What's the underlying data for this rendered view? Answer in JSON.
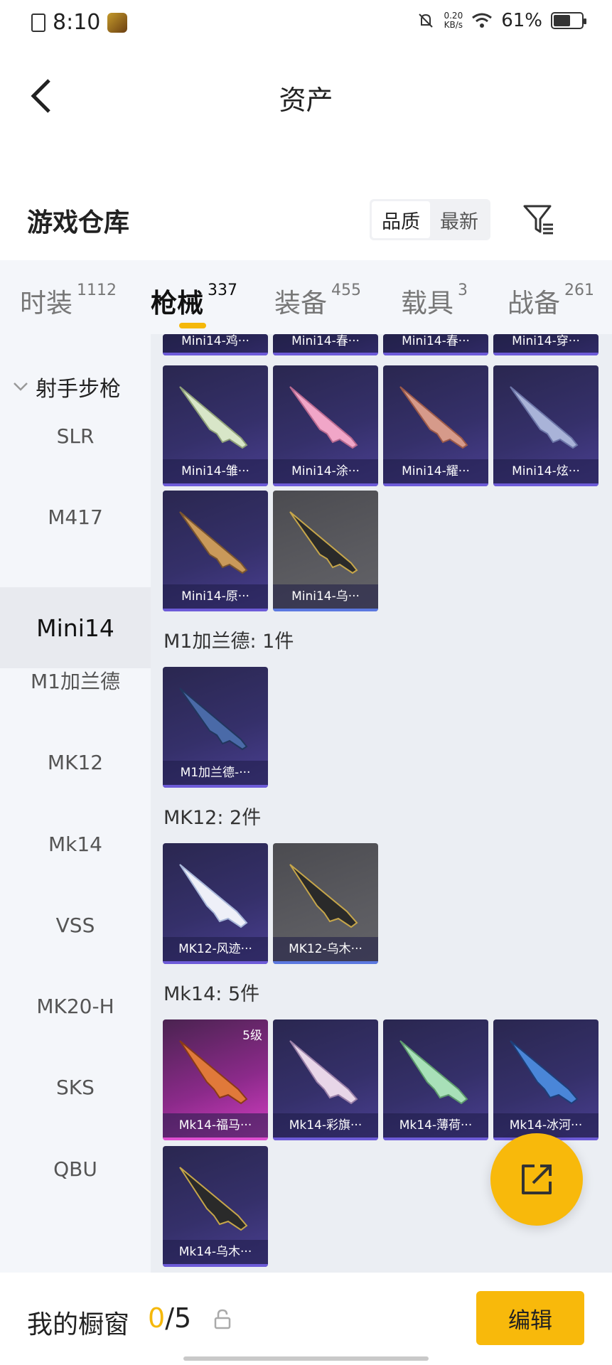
{
  "status_bar": {
    "time": "8:10",
    "net_speed_top": "0.20",
    "net_speed_bottom": "KB/s",
    "battery": "61%",
    "battery_level": 0.61
  },
  "header": {
    "title": "资产"
  },
  "warehouse": {
    "title": "游戏仓库",
    "sort": [
      "品质",
      "最新"
    ],
    "sort_active": "品质"
  },
  "tabs": [
    {
      "label": "时装",
      "count": "1112"
    },
    {
      "label": "枪械",
      "count": "337",
      "active": true
    },
    {
      "label": "装备",
      "count": "455"
    },
    {
      "label": "载具",
      "count": "3"
    },
    {
      "label": "战备",
      "count": "261"
    }
  ],
  "side": {
    "group": "射手步枪",
    "items": [
      "SLR",
      "M417",
      "Mini14",
      "M1加兰德",
      "MK12",
      "Mk14",
      "VSS",
      "MK20-H",
      "SKS",
      "QBU"
    ],
    "active": "Mini14"
  },
  "grid": {
    "partial_row": [
      "Mini14-鸡···",
      "Mini14-春···",
      "Mini14-春···",
      "Mini14-穿···"
    ],
    "mini14_items": [
      "Mini14-雏···",
      "Mini14-涂···",
      "Mini14-耀···",
      "Mini14-炫···",
      "Mini14-原···",
      "Mini14-乌···"
    ],
    "m1_section": "M1加兰德: 1件",
    "m1_items": [
      "M1加兰德-···"
    ],
    "mk12_section": "MK12: 2件",
    "mk12_items": [
      "MK12-风迹···",
      "MK12-乌木···"
    ],
    "mk14_section": "Mk14: 5件",
    "mk14_items": [
      "Mk14-福马···",
      "Mk14-彩旗···",
      "Mk14-薄荷···",
      "Mk14-冰河···",
      "Mk14-乌木···"
    ],
    "mk14_level": "5级"
  },
  "bottom": {
    "showcase_label": "我的橱窗",
    "showcase_current": "0",
    "showcase_total": "/5",
    "edit_label": "编辑"
  },
  "colors": {
    "accent": "#f8b90b",
    "card_purple": "#35306a",
    "card_gray": "#5b5b60",
    "card_pink": "#d63fc4"
  }
}
